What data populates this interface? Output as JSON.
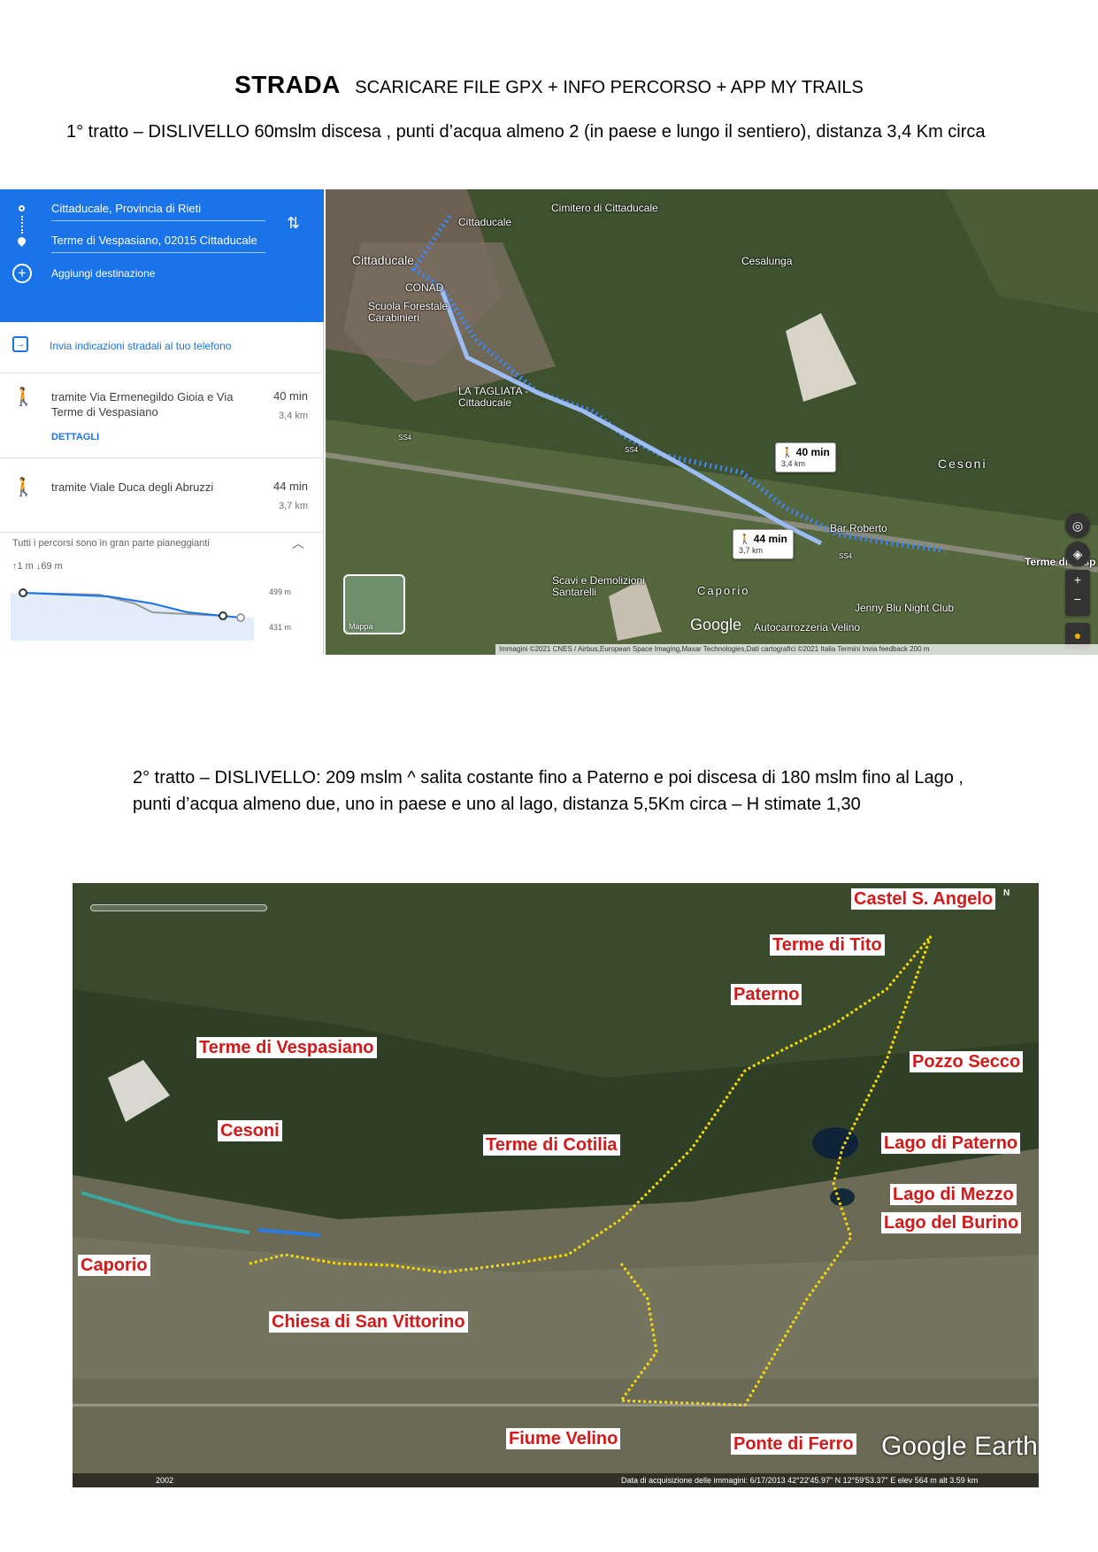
{
  "header": {
    "title": "STRADA",
    "subtitle": "SCARICARE FILE GPX + INFO PERCORSO + APP MY TRAILS"
  },
  "section1": {
    "text": "1° tratto – DISLIVELLO 60mslm  discesa , punti d’acqua almeno 2 (in paese e lungo il sentiero), distanza 3,4 Km circa"
  },
  "maps_panel": {
    "origin": "Cittaducale, Provincia di Rieti",
    "destination": "Terme di Vespasiano, 02015 Cittaducale",
    "add_destination": "Aggiungi destinazione",
    "send_to_phone": "Invia indicazioni stradali al tuo telefono",
    "routes": [
      {
        "via": "tramite Via Ermenegildo Gioia e Via Terme di Vespasiano",
        "time": "40 min",
        "distance": "3,4 km",
        "details": "DETTAGLI"
      },
      {
        "via": "tramite Viale Duca degli Abruzzi",
        "time": "44 min",
        "distance": "3,7 km"
      }
    ],
    "elevation": {
      "title": "Tutti i percorsi sono in gran parte pianeggianti",
      "stats": "↑1 m  ↓69 m",
      "max_label": "499 m",
      "min_label": "431 m"
    }
  },
  "map_view": {
    "labels": [
      "Cittaducale",
      "Cimitero di Cittaducale",
      "Cittaducale",
      "Cesalunga",
      "CONAD",
      "Scuola Forestale Carabinieri",
      "LA TAGLIATA - Cittaducale",
      "Cesoni",
      "Bar Roberto",
      "Terme di Vesp",
      "Scavi e Demolizioni Santarelli",
      "Caporio",
      "Jenny Blu Night Club",
      "Autocarrozzeria Velino",
      "SS4",
      "SS4",
      "SS4"
    ],
    "time_boxes": [
      {
        "time": "40 min",
        "distance": "3,4 km"
      },
      {
        "time": "44 min",
        "distance": "3,7 km"
      }
    ],
    "mini_map_label": "Mappa",
    "logo": "Google",
    "attribution": "Immagini ©2021 CNES / Airbus,European Space Imaging,Maxar Technologies,Dati cartografici ©2021     Italia     Termini     Invia feedback     200 m"
  },
  "section2": {
    "line1": "2° tratto – DISLIVELLO: 209 mslm ^ salita costante fino a Paterno e poi discesa di 180 mslm fino al Lago ,",
    "line2": "punti d’acqua almeno due, uno in paese e uno al lago, distanza 5,5Km circa – H stimate 1,30"
  },
  "earth_view": {
    "labels": [
      "Castel S. Angelo",
      "Terme di Tito",
      "Paterno",
      "Terme di Vespasiano",
      "Pozzo Secco",
      "Cesoni",
      "Terme di Cotilia",
      "Lago di Paterno",
      "Lago di Mezzo",
      "Lago del Burino",
      "Caporio",
      "Chiesa di San Vittorino",
      "Fiume Velino",
      "Ponte di Ferro"
    ],
    "logo": "Google Earth",
    "footer_left": "2002",
    "footer": "Data di acquisizione delle immagini: 6/17/2013     42°22'45.97\" N     12°59'53.37\" E  elev  564 m     alt  3.59 km",
    "compass": "N",
    "colors": {
      "label_text": "#d31a1a",
      "track": "#f5d90a"
    }
  }
}
